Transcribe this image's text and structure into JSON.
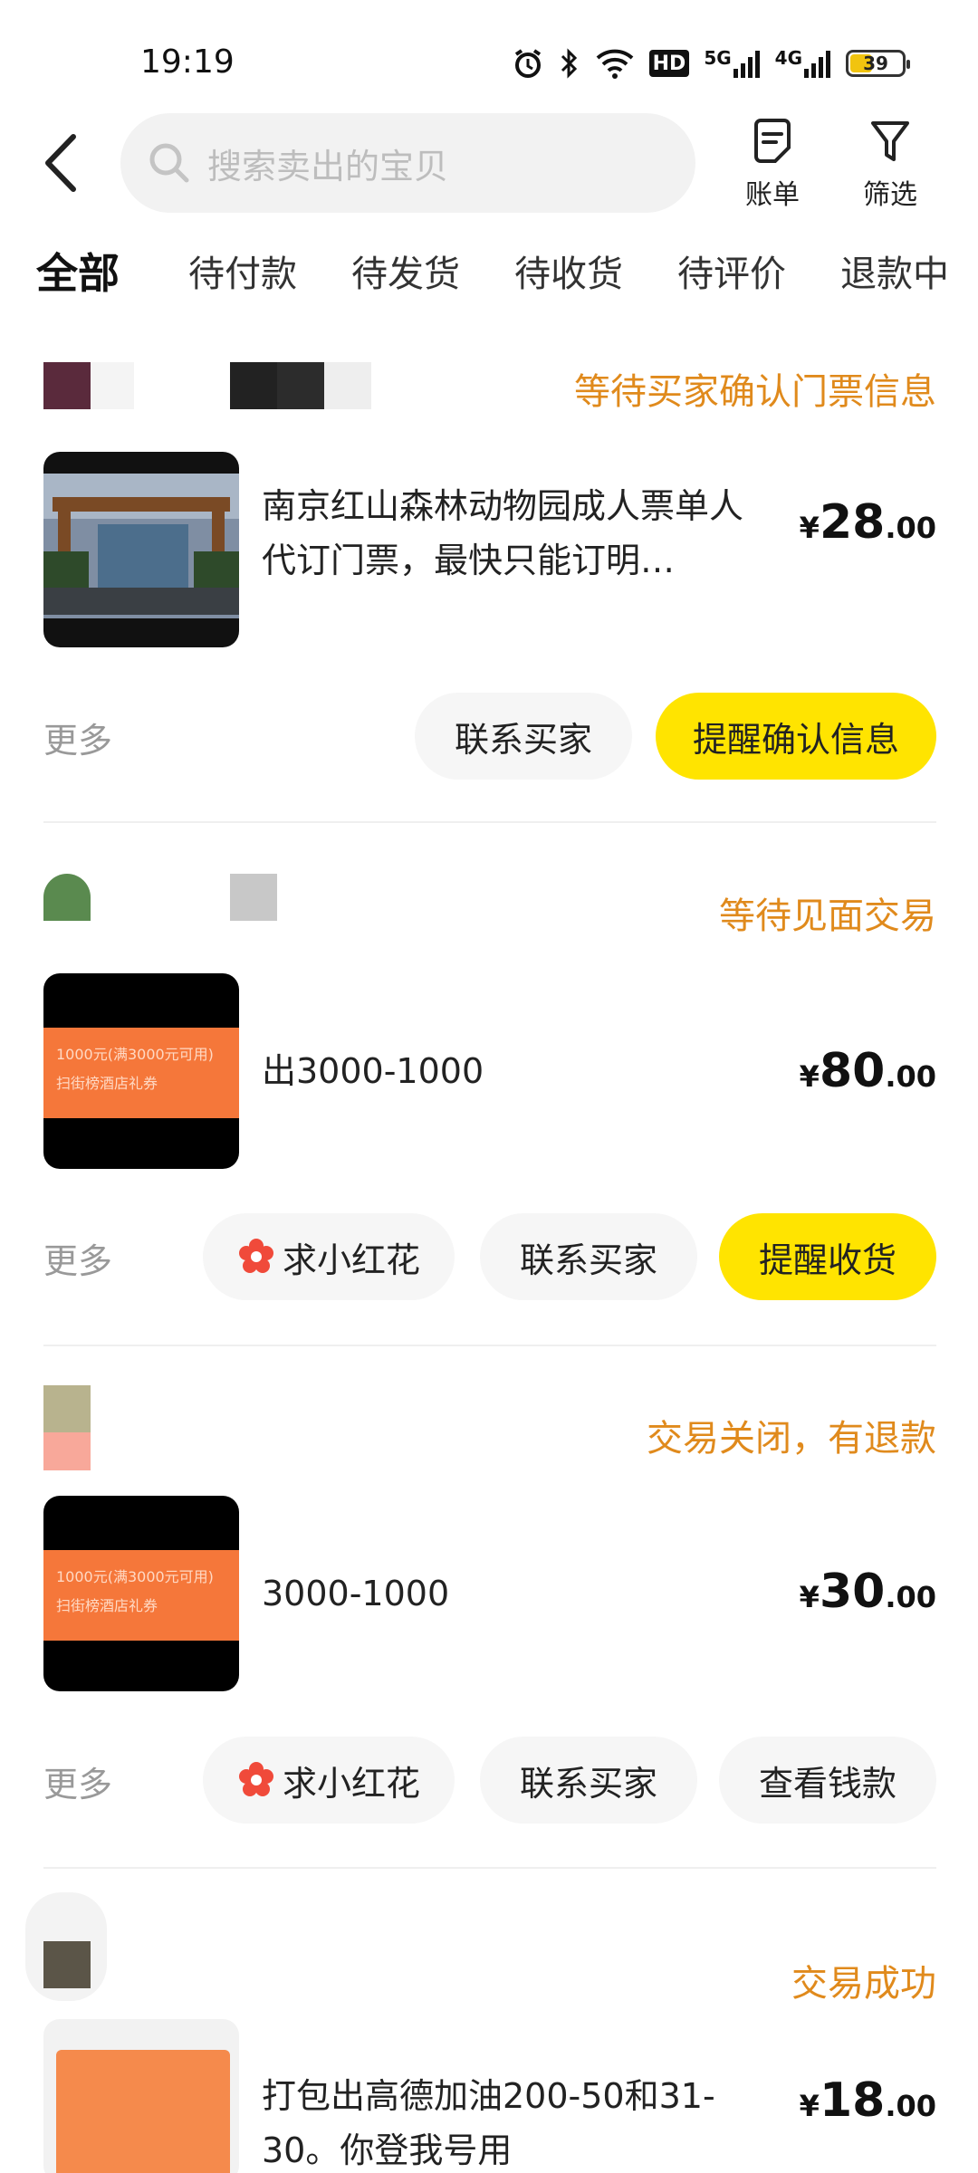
{
  "status_bar": {
    "time": "19:19",
    "signal_labels": [
      "HD",
      "5G",
      "4G"
    ],
    "battery": "39"
  },
  "header": {
    "search_placeholder": "搜索卖出的宝贝",
    "bill_label": "账单",
    "filter_label": "筛选"
  },
  "tabs": [
    {
      "label": "全部",
      "active": true
    },
    {
      "label": "待付款",
      "active": false
    },
    {
      "label": "待发货",
      "active": false
    },
    {
      "label": "待收货",
      "active": false
    },
    {
      "label": "待评价",
      "active": false
    },
    {
      "label": "退款中",
      "active": false
    }
  ],
  "orders": [
    {
      "status": "等待买家确认门票信息",
      "title": "南京红山森林动物园成人票单人代订门票，最快只能订明…",
      "price": {
        "currency": "¥",
        "int": "28",
        "dec": ".00"
      },
      "more": "更多",
      "buttons": [
        "联系买家",
        "提醒确认信息"
      ]
    },
    {
      "status": "等待见面交易",
      "title": "出3000-1000",
      "thumb_text": [
        "1000元(满3000元可用)",
        "扫街榜酒店礼券"
      ],
      "price": {
        "currency": "¥",
        "int": "80",
        "dec": ".00"
      },
      "more": "更多",
      "buttons": [
        "求小红花",
        "联系买家",
        "提醒收货"
      ]
    },
    {
      "status": "交易关闭，有退款",
      "title": "3000-1000",
      "thumb_text": [
        "1000元(满3000元可用)",
        "扫街榜酒店礼券"
      ],
      "price": {
        "currency": "¥",
        "int": "30",
        "dec": ".00"
      },
      "more": "更多",
      "buttons": [
        "求小红花",
        "联系买家",
        "查看钱款"
      ]
    },
    {
      "status": "交易成功",
      "title": "打包出高德加油200-50和31-30。你登我号用",
      "price": {
        "currency": "¥",
        "int": "18",
        "dec": ".00"
      }
    }
  ],
  "colors": {
    "accent_yellow": "#ffe400",
    "status_orange": "#e08a1c",
    "coupon_orange": "#f5773a"
  }
}
